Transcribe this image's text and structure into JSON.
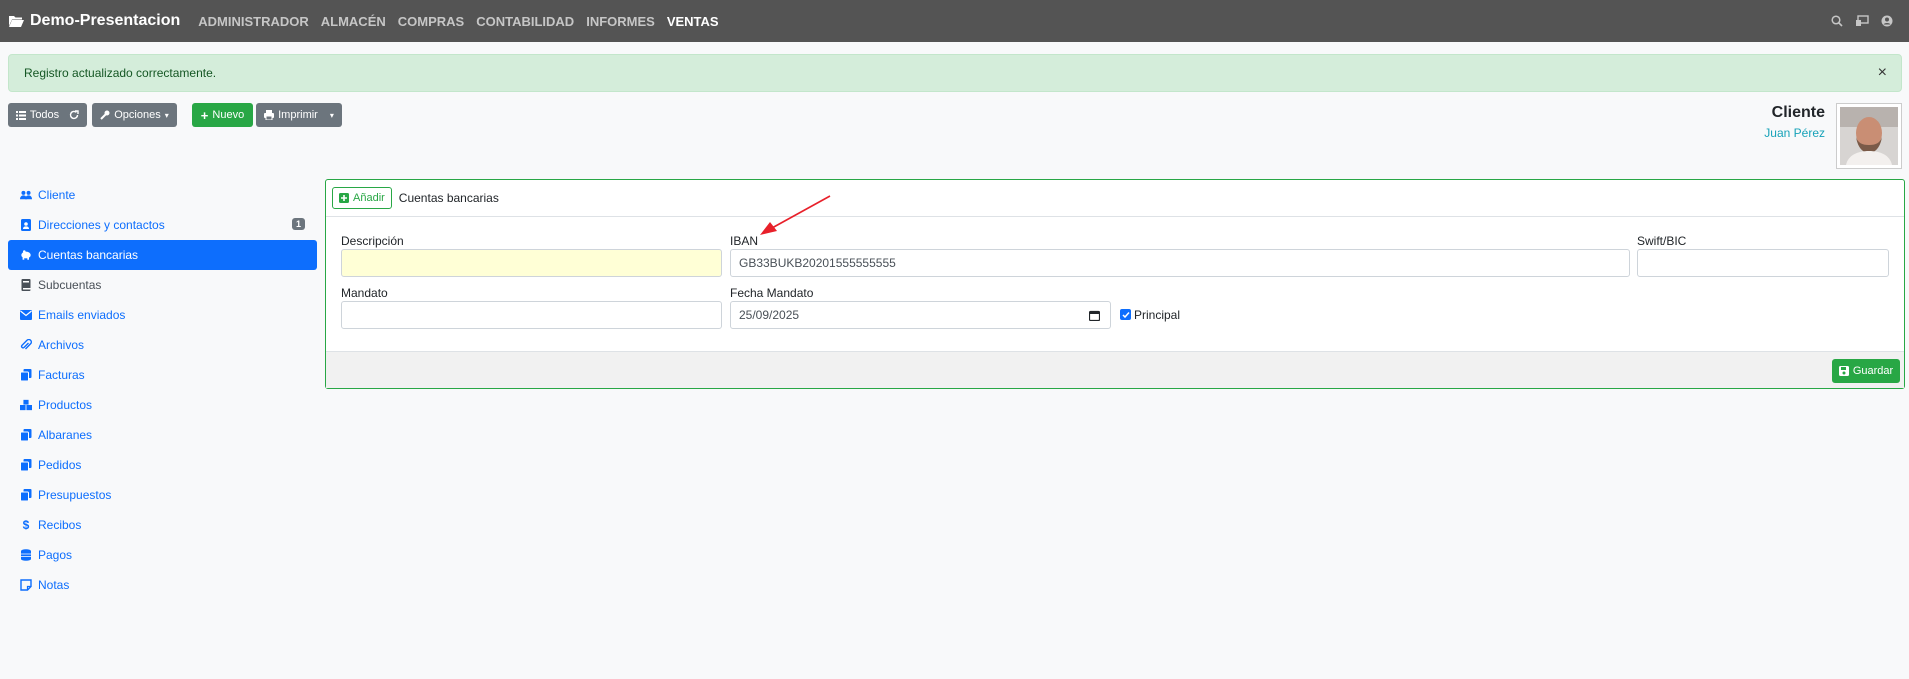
{
  "navbar": {
    "brand": "Demo-Presentacion",
    "menu": [
      "ADMINISTRADOR",
      "ALMACÉN",
      "COMPRAS",
      "CONTABILIDAD",
      "INFORMES",
      "VENTAS"
    ],
    "active": "VENTAS",
    "icons": [
      "search-icon",
      "store-icon",
      "user-icon"
    ]
  },
  "alert": {
    "message": "Registro actualizado correctamente.",
    "close": "×"
  },
  "toolbar": {
    "todos": "Todos",
    "opciones": "Opciones",
    "nuevo": "Nuevo",
    "imprimir": "Imprimir"
  },
  "client": {
    "title": "Cliente",
    "name": "Juan Pérez"
  },
  "sidebar": {
    "items": [
      {
        "label": "Cliente",
        "icon": "users-icon"
      },
      {
        "label": "Direcciones y contactos",
        "icon": "address-card-icon",
        "badge": "1"
      },
      {
        "label": "Cuentas bancarias",
        "icon": "piggy-bank-icon",
        "active": true
      },
      {
        "label": "Subcuentas",
        "icon": "book-icon"
      },
      {
        "label": "Emails enviados",
        "icon": "envelope-icon"
      },
      {
        "label": "Archivos",
        "icon": "paperclip-icon"
      },
      {
        "label": "Facturas",
        "icon": "copy-icon"
      },
      {
        "label": "Productos",
        "icon": "cubes-icon"
      },
      {
        "label": "Albaranes",
        "icon": "copy-icon"
      },
      {
        "label": "Pedidos",
        "icon": "copy-icon"
      },
      {
        "label": "Presupuestos",
        "icon": "copy-icon"
      },
      {
        "label": "Recibos",
        "icon": "dollar-icon"
      },
      {
        "label": "Pagos",
        "icon": "coins-icon"
      },
      {
        "label": "Notas",
        "icon": "sticky-note-icon"
      }
    ]
  },
  "panel": {
    "add_label": "Añadir",
    "title": "Cuentas bancarias",
    "fields": {
      "descripcion": {
        "label": "Descripción",
        "value": ""
      },
      "iban": {
        "label": "IBAN",
        "value": "GB33BUKB20201555555555"
      },
      "swift": {
        "label": "Swift/BIC",
        "value": ""
      },
      "mandato": {
        "label": "Mandato",
        "value": ""
      },
      "fecha_mandato": {
        "label": "Fecha Mandato",
        "value": "25/09/2025"
      },
      "principal": {
        "label": "Principal",
        "checked": true
      }
    },
    "save_label": "Guardar"
  },
  "colors": {
    "navbar": "#545454",
    "primary": "#0d6efd",
    "success": "#28a745",
    "alert_bg": "#d4edda",
    "annotation_arrow": "#e8202a"
  }
}
